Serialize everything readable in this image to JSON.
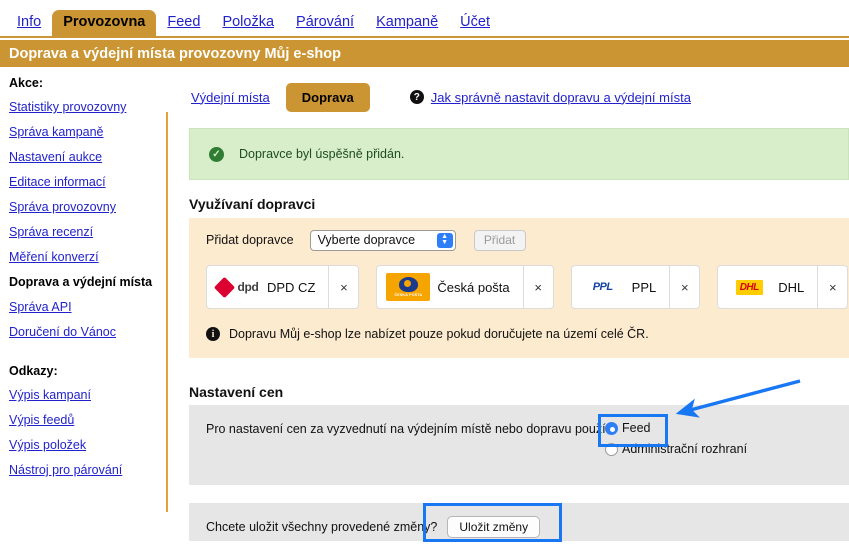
{
  "topnav": {
    "tabs": [
      {
        "label": "Info",
        "active": false
      },
      {
        "label": "Provozovna",
        "active": true
      },
      {
        "label": "Feed",
        "active": false
      },
      {
        "label": "Položka",
        "active": false
      },
      {
        "label": "Párování",
        "active": false
      },
      {
        "label": "Kampaně",
        "active": false
      },
      {
        "label": "Účet",
        "active": false
      }
    ]
  },
  "page_header": {
    "title": "Doprava a výdejní místa provozovny Můj e-shop"
  },
  "sidebar": {
    "actions_heading": "Akce:",
    "items": [
      {
        "label": "Statistiky provozovny",
        "current": false
      },
      {
        "label": "Správa kampaně",
        "current": false
      },
      {
        "label": "Nastavení aukce",
        "current": false
      },
      {
        "label": "Editace informací",
        "current": false
      },
      {
        "label": "Správa provozovny",
        "current": false
      },
      {
        "label": "Správa recenzí",
        "current": false
      },
      {
        "label": "Měření konverzí",
        "current": false
      },
      {
        "label": "Doprava a výdejní místa",
        "current": true
      },
      {
        "label": "Správa API",
        "current": false
      },
      {
        "label": "Doručení do Vánoc",
        "current": false
      }
    ],
    "links_heading": "Odkazy:",
    "links": [
      {
        "label": "Výpis kampaní"
      },
      {
        "label": "Výpis feedů"
      },
      {
        "label": "Výpis položek"
      },
      {
        "label": "Nástroj pro párování"
      }
    ]
  },
  "subtabs": {
    "pickup_points": "Výdejní místa",
    "shipping": "Doprava",
    "help_icon": "question-mark-icon",
    "help_link": "Jak správně nastavit dopravu a výdejní místa"
  },
  "banner": {
    "icon": "check-circle-icon",
    "text": "Dopravce byl úspěšně přidán."
  },
  "carriers_section": {
    "title": "Využívaní dopravci",
    "add_label": "Přidat dopravce",
    "select_value": "Vyberte dopravce",
    "add_button": "Přidat",
    "remove_icon": "close-icon",
    "chips": [
      {
        "logo": "dpd-logo",
        "logo_text": "dpd",
        "name": "DPD CZ"
      },
      {
        "logo": "ceska-posta-logo",
        "logo_text": "ČESKÁ POŠTA",
        "name": "Česká pošta"
      },
      {
        "logo": "ppl-logo",
        "logo_text": "PPL",
        "name": "PPL"
      },
      {
        "logo": "dhl-logo",
        "logo_text": "DHL",
        "name": "DHL"
      }
    ],
    "note_icon": "info-icon",
    "note": "Dopravu Můj e-shop lze nabízet pouze pokud doručujete na území celé ČR."
  },
  "price_section": {
    "title": "Nastavení cen",
    "question": "Pro nastavení cen za vyzvednutí na výdejním místě nebo dopravu použít:",
    "options": [
      {
        "label": "Feed",
        "selected": true
      },
      {
        "label": "Administrační rozhraní",
        "selected": false
      }
    ]
  },
  "save_section": {
    "question": "Chcete uložit všechny provedené změny?",
    "button": "Uložit změny"
  },
  "annotations": {
    "highlight_color": "#1877F2",
    "arrow": "blue-arrow-pointing-to-feed-radio"
  }
}
